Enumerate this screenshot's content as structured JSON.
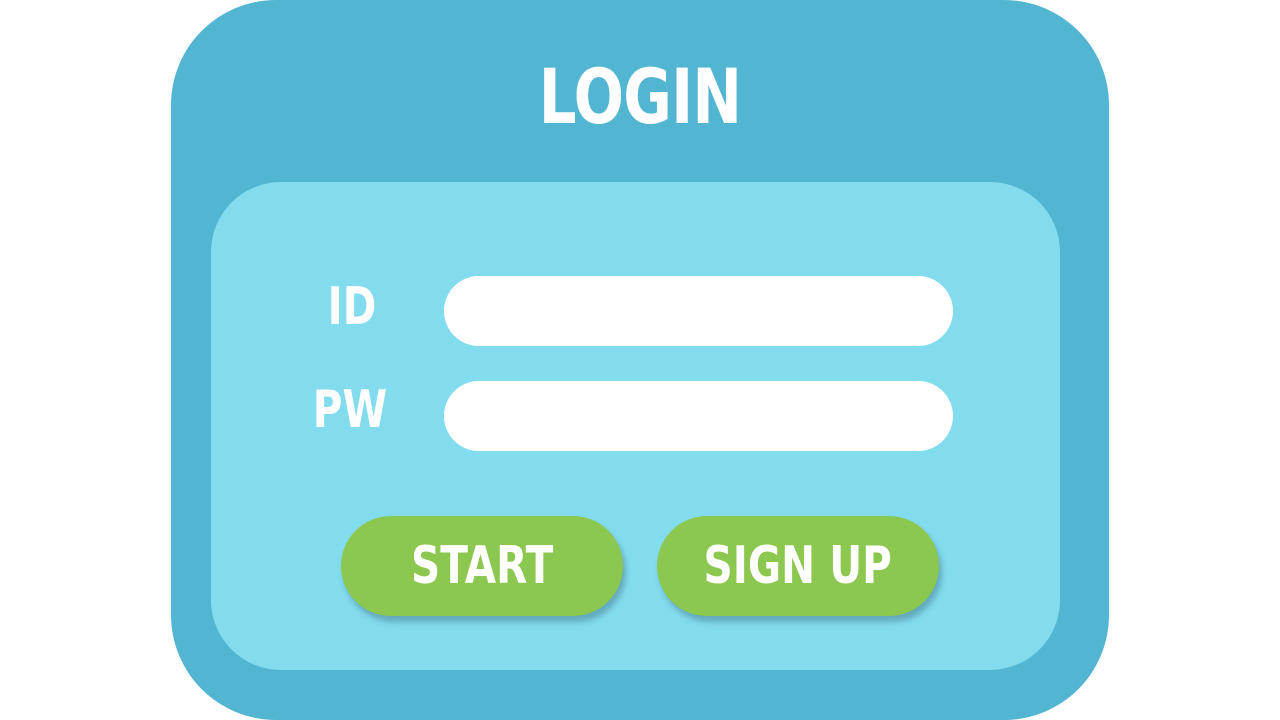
{
  "title": "LOGIN",
  "form": {
    "id_label": "ID",
    "pw_label": "PW",
    "id_value": "",
    "pw_value": ""
  },
  "buttons": {
    "start_label": "START",
    "signup_label": "SIGN UP"
  },
  "colors": {
    "outer_panel": "#52b6d3",
    "inner_panel": "#83dcee",
    "button": "#8cc74f",
    "input": "#ffffff",
    "text": "#ffffff"
  }
}
